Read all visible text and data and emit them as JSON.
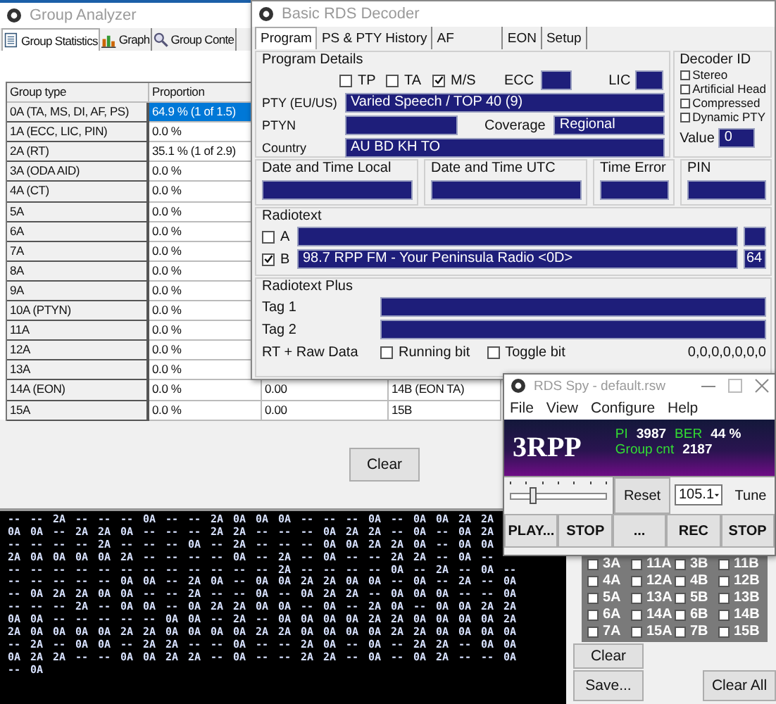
{
  "group_analyzer": {
    "title": "Group Analyzer",
    "tabs": [
      {
        "label": "Group Statistics",
        "selected": true,
        "kind": "stats"
      },
      {
        "label": "Graph",
        "selected": false,
        "kind": "graph"
      },
      {
        "label": "Group Conte",
        "selected": false,
        "kind": "search"
      }
    ],
    "table": {
      "columns": [
        "Group type",
        "Proportion"
      ],
      "rows": [
        {
          "cells": [
            "0A (TA, MS, DI, AF, PS)",
            "64.9 % (1 of 1.5)"
          ],
          "selected": true
        },
        {
          "cells": [
            "1A (ECC, LIC, PIN)",
            "0.0 %"
          ],
          "selected": false
        },
        {
          "cells": [
            "2A (RT)",
            "35.1 % (1 of 2.9)"
          ],
          "selected": false
        },
        {
          "cells": [
            "3A (ODA AID)",
            "0.0 %"
          ],
          "selected": false
        },
        {
          "cells": [
            "4A (CT)",
            "0.0 %"
          ],
          "selected": false
        },
        {
          "cells": [
            "5A",
            "0.0 %"
          ],
          "selected": false
        },
        {
          "cells": [
            "6A",
            "0.0 %"
          ],
          "selected": false
        },
        {
          "cells": [
            "7A",
            "0.0 %"
          ],
          "selected": false
        },
        {
          "cells": [
            "8A",
            "0.0 %"
          ],
          "selected": false
        },
        {
          "cells": [
            "9A",
            "0.0 %"
          ],
          "selected": false
        },
        {
          "cells": [
            "10A (PTYN)",
            "0.0 %"
          ],
          "selected": false
        },
        {
          "cells": [
            "11A",
            "0.0 %"
          ],
          "selected": false
        },
        {
          "cells": [
            "12A",
            "0.0 %"
          ],
          "selected": false
        },
        {
          "cells": [
            "13A",
            "0.0 %"
          ],
          "selected": false
        },
        {
          "cells": [
            "14A (EON)",
            "0.0 %",
            "0.00",
            "14B (EON TA)"
          ],
          "selected": false
        },
        {
          "cells": [
            "15A",
            "0.0 %",
            "0.00",
            "15B"
          ],
          "selected": false
        }
      ]
    },
    "clear_button": "Clear",
    "group_sequence": [
      [
        "--",
        "--",
        "2A",
        "--",
        "--",
        "--",
        "0A",
        "--",
        "--",
        "2A",
        "0A",
        "0A",
        "0A",
        "--",
        "--",
        "--",
        "0A",
        "--",
        "0A",
        "0A",
        "2A",
        "2A"
      ],
      [
        "0A",
        "0A",
        "--",
        "2A",
        "2A",
        "0A",
        "--",
        "--",
        "--",
        "2A",
        "2A",
        "--",
        "--",
        "--",
        "0A",
        "2A",
        "2A",
        "--",
        "0A",
        "--",
        "0A",
        "2A"
      ],
      [
        "--",
        "--",
        "--",
        "--",
        "2A",
        "--",
        "--",
        "--",
        "0A",
        "--",
        "2A",
        "--",
        "--",
        "--",
        "0A",
        "0A",
        "2A",
        "2A",
        "0A",
        "--",
        "0A",
        "0A"
      ],
      [
        "2A",
        "0A",
        "0A",
        "0A",
        "0A",
        "2A",
        "--",
        "--",
        "--",
        "--",
        "0A",
        "--",
        "2A",
        "--",
        "0A",
        "--",
        "--",
        "2A",
        "2A",
        "--",
        "0A",
        "--"
      ],
      [
        "--",
        "--",
        "--",
        "--",
        "--",
        "--",
        "--",
        "--",
        "--",
        "--",
        "--",
        "--",
        "2A",
        "--",
        "--",
        "--",
        "--",
        "0A",
        "--",
        "2A",
        "--",
        "0A",
        "--"
      ],
      [
        "--",
        "--",
        "--",
        "--",
        "--",
        "0A",
        "0A",
        "--",
        "2A",
        "0A",
        "--",
        "0A",
        "0A",
        "2A",
        "2A",
        "0A",
        "0A",
        "--",
        "0A",
        "--",
        "2A",
        "--",
        "0A"
      ],
      [
        "--",
        "0A",
        "2A",
        "2A",
        "0A",
        "0A",
        "--",
        "--",
        "2A",
        "--",
        "--",
        "0A",
        "--",
        "0A",
        "2A",
        "2A",
        "--",
        "0A",
        "0A",
        "0A",
        "--",
        "--",
        "0A"
      ],
      [
        "--",
        "--",
        "--",
        "2A",
        "--",
        "0A",
        "0A",
        "--",
        "0A",
        "2A",
        "2A",
        "0A",
        "0A",
        "--",
        "0A",
        "--",
        "2A",
        "0A",
        "--",
        "0A",
        "0A",
        "2A",
        "2A"
      ],
      [
        "0A",
        "0A",
        "--",
        "--",
        "--",
        "--",
        "--",
        "0A",
        "0A",
        "--",
        "2A",
        "--",
        "0A",
        "0A",
        "0A",
        "0A",
        "2A",
        "2A",
        "0A",
        "0A",
        "0A",
        "0A",
        "2A"
      ],
      [
        "2A",
        "0A",
        "0A",
        "0A",
        "0A",
        "2A",
        "2A",
        "0A",
        "0A",
        "0A",
        "0A",
        "2A",
        "2A",
        "0A",
        "0A",
        "0A",
        "0A",
        "2A",
        "2A",
        "0A",
        "0A",
        "0A",
        "0A"
      ],
      [
        "--",
        "2A",
        "--",
        "0A",
        "0A",
        "--",
        "2A",
        "2A",
        "--",
        "--",
        "0A",
        "--",
        "--",
        "2A",
        "0A",
        "--",
        "0A",
        "--",
        "2A",
        "2A",
        "--",
        "0A",
        "0A"
      ],
      [
        "0A",
        "2A",
        "2A",
        "--",
        "--",
        "0A",
        "0A",
        "2A",
        "2A",
        "--",
        "0A",
        "--",
        "--",
        "2A",
        "2A",
        "--",
        "0A",
        "--",
        "0A",
        "2A",
        "--",
        "--",
        "0A"
      ],
      [
        "--",
        "0A"
      ]
    ],
    "group_filter": [
      {
        "label": "3A",
        "checked": false
      },
      {
        "label": "11A",
        "checked": false
      },
      {
        "label": "3B",
        "checked": false
      },
      {
        "label": "11B",
        "checked": false
      },
      {
        "label": "4A",
        "checked": false
      },
      {
        "label": "12A",
        "checked": false
      },
      {
        "label": "4B",
        "checked": false
      },
      {
        "label": "12B",
        "checked": false
      },
      {
        "label": "5A",
        "checked": false
      },
      {
        "label": "13A",
        "checked": false
      },
      {
        "label": "5B",
        "checked": false
      },
      {
        "label": "13B",
        "checked": false
      },
      {
        "label": "6A",
        "checked": false
      },
      {
        "label": "14A",
        "checked": false
      },
      {
        "label": "6B",
        "checked": false
      },
      {
        "label": "14B",
        "checked": false
      },
      {
        "label": "7A",
        "checked": false
      },
      {
        "label": "15A",
        "checked": false
      },
      {
        "label": "7B",
        "checked": false
      },
      {
        "label": "15B",
        "checked": false
      }
    ],
    "filter_clear_button": "Clear",
    "save_button": "Save...",
    "clear_all_button": "Clear All"
  },
  "decoder": {
    "title": "Basic RDS Decoder",
    "tabs": [
      {
        "label": "Program",
        "selected": true
      },
      {
        "label": "PS & PTY History",
        "selected": false
      },
      {
        "label": "AF",
        "selected": false
      },
      {
        "label": "EON",
        "selected": false
      },
      {
        "label": "Setup",
        "selected": false
      }
    ],
    "program_details": {
      "title": "Program Details",
      "flags": [
        {
          "label": "TP",
          "checked": false
        },
        {
          "label": "TA",
          "checked": false
        },
        {
          "label": "M/S",
          "checked": true
        }
      ],
      "ecc_label": "ECC",
      "lic_label": "LIC",
      "pty_label": "PTY (EU/US)",
      "pty": "Varied Speech / TOP 40 (9)",
      "ptyn_label": "PTYN",
      "coverage_label": "Coverage",
      "coverage": "Regional",
      "country_label": "Country",
      "country": "AU BD KH TO"
    },
    "decoder_id": {
      "title": "Decoder ID",
      "flags": [
        {
          "label": "Stereo",
          "checked": false
        },
        {
          "label": "Artificial Head",
          "checked": false
        },
        {
          "label": "Compressed",
          "checked": false
        },
        {
          "label": "Dynamic PTY",
          "checked": false
        }
      ],
      "value_label": "Value",
      "value": "0"
    },
    "time_boxes": [
      {
        "title": "Date and Time Local"
      },
      {
        "title": "Date and Time UTC"
      },
      {
        "title": "Time Error"
      },
      {
        "title": "PIN"
      }
    ],
    "radiotext": {
      "title": "Radiotext",
      "lines": [
        {
          "label": "A",
          "checked": false
        },
        {
          "label": "B",
          "checked": true,
          "text": "98.7 RPP FM - Your Peninsula Radio <0D>",
          "length": "64"
        }
      ]
    },
    "radiotext_plus": {
      "title": "Radiotext Plus",
      "tags": [
        "Tag 1",
        "Tag 2"
      ],
      "raw_label": "RT + Raw Data",
      "bits": [
        {
          "label": "Running bit",
          "checked": false
        },
        {
          "label": "Toggle bit",
          "checked": false
        }
      ],
      "raw": "0,0,0,0,0,0,0"
    }
  },
  "spy": {
    "title": "RDS Spy - default.rsw",
    "menu": [
      "File",
      "View",
      "Configure",
      "Help"
    ],
    "ps": "3RPP",
    "pi_label": "PI",
    "pi": "3987",
    "ber_label": "BER",
    "ber": "44 %",
    "group_count_label": "Group cnt",
    "group_count": "2187",
    "slider": {
      "level": 0.22
    },
    "reset": "Reset",
    "frequency": "105.1",
    "tune": "Tune",
    "buttons": [
      "PLAY...",
      "STOP",
      "...",
      "REC",
      "STOP"
    ]
  }
}
